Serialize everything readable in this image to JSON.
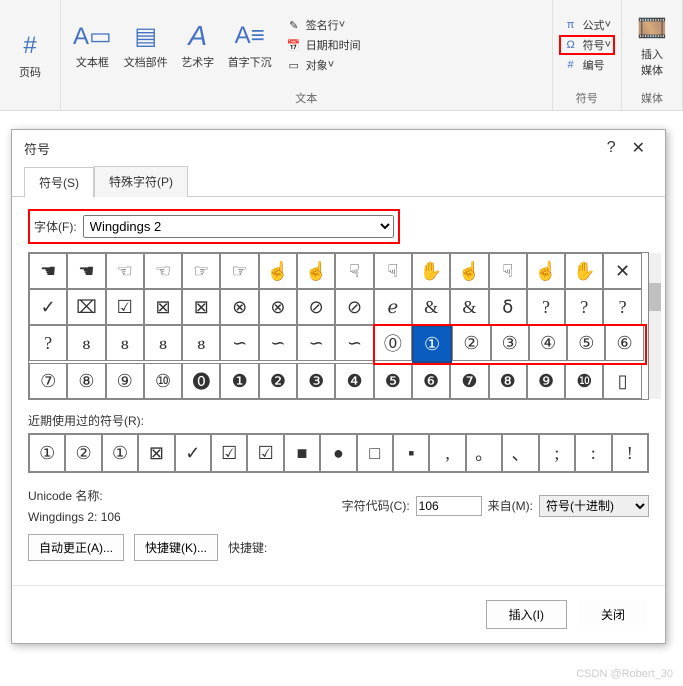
{
  "ribbon": {
    "pageNum": "页码",
    "textBox": "文本框",
    "docParts": "文档部件",
    "wordArt": "艺术字",
    "dropCap": "首字下沉",
    "sigLine": "签名行",
    "dateTime": "日期和时间",
    "object": "对象",
    "equation": "公式",
    "symbol": "符号",
    "numbering": "编号",
    "media": "插入\n媒体",
    "gText": "文本",
    "gSymbol": "符号",
    "gMedia": "媒体"
  },
  "dialog": {
    "title": "符号",
    "help": "?",
    "close": "✕",
    "tabSymbol": "符号(S)",
    "tabSpecial": "特殊字符(P)",
    "fontLabel": "字体(F):",
    "fontValue": "Wingdings 2",
    "recentLabel": "近期使用过的符号(R):",
    "unicodeLabel": "Unicode 名称:",
    "unicodeValue": "Wingdings 2: 106",
    "charCodeLabel": "字符代码(C):",
    "charCodeValue": "106",
    "fromLabel": "来自(M):",
    "fromValue": "符号(十进制)",
    "autoCorrect": "自动更正(A)...",
    "shortcutBtn": "快捷键(K)...",
    "shortcutLabel": "快捷键:",
    "insert": "插入(I)",
    "close2": "关闭"
  },
  "grid": [
    [
      "☚",
      "☚",
      "☜",
      "☜",
      "☞",
      "☞",
      "☝",
      "☝",
      "☟",
      "☟",
      "✋",
      "☝",
      "☟",
      "☝",
      "✋",
      "✕"
    ],
    [
      "✓",
      "⌧",
      "☑",
      "⊠",
      "⊠",
      "⊗",
      "⊗",
      "⊘",
      "⊘",
      "ℯ",
      "&",
      "&",
      "ẟ",
      "?",
      "?",
      "?"
    ],
    [
      "?",
      "ᴕ",
      "ᴕ",
      "ᴕ",
      "ᴕ",
      "∽",
      "∽",
      "∽",
      "∽",
      "⓪",
      "①",
      "②",
      "③",
      "④",
      "⑤",
      "⑥"
    ],
    [
      "⑦",
      "⑧",
      "⑨",
      "⑩",
      "⓿",
      "❶",
      "❷",
      "❸",
      "❹",
      "❺",
      "❻",
      "❼",
      "❽",
      "❾",
      "❿",
      "▯"
    ]
  ],
  "recent": [
    "①",
    "②",
    "①",
    "⊠",
    "✓",
    "☑",
    "☑",
    "■",
    "●",
    "□",
    "▪",
    ",",
    "。",
    "、",
    ";",
    ":",
    "!"
  ],
  "watermark": "CSDN @Robert_30",
  "chart_data": {
    "type": "table",
    "note": "symbol picker grid, not a data chart"
  }
}
